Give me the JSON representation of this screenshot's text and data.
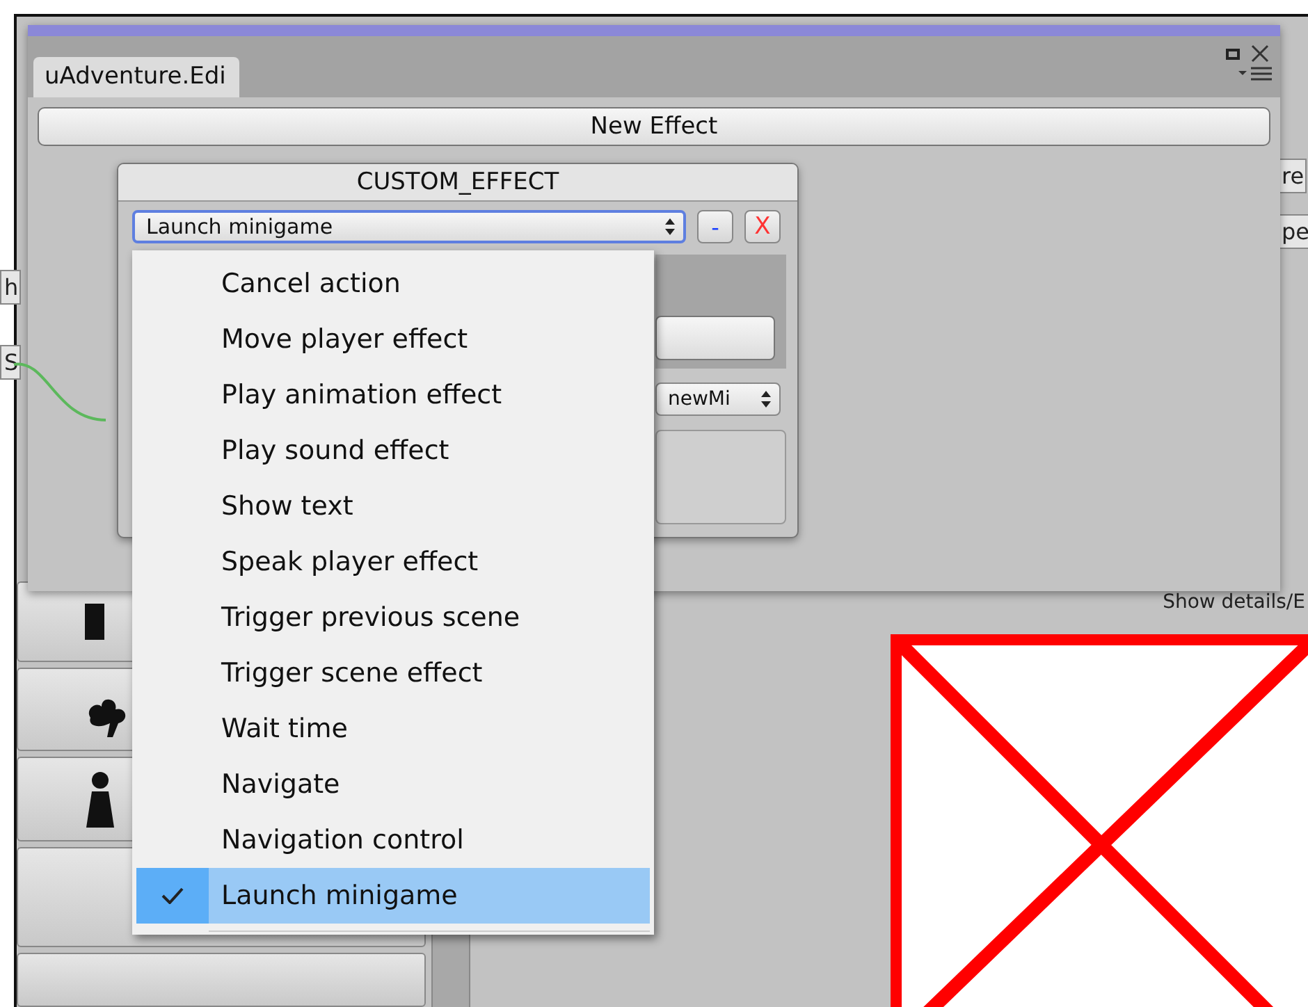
{
  "background": {
    "left_labels": [
      "h",
      "S"
    ],
    "right_labels": [
      "re",
      "pe"
    ],
    "details_label": "Show details/E"
  },
  "window": {
    "tab": "uAdventure.Edi",
    "new_effect_button": "New Effect"
  },
  "node": {
    "title": "CUSTOM_EFFECT",
    "effect_select": "Launch minigame",
    "remove_button": "-",
    "delete_button": "X",
    "minigame_select": "newMi"
  },
  "menu": {
    "items": [
      {
        "label": "Cancel action",
        "selected": false
      },
      {
        "label": "Move player effect",
        "selected": false
      },
      {
        "label": "Play animation effect",
        "selected": false
      },
      {
        "label": "Play sound effect",
        "selected": false
      },
      {
        "label": "Show text",
        "selected": false
      },
      {
        "label": "Speak player effect",
        "selected": false
      },
      {
        "label": "Trigger previous scene",
        "selected": false
      },
      {
        "label": "Trigger scene effect",
        "selected": false
      },
      {
        "label": "Wait time",
        "selected": false
      },
      {
        "label": "Navigate",
        "selected": false
      },
      {
        "label": "Navigation control",
        "selected": false
      },
      {
        "label": "Launch minigame",
        "selected": true
      }
    ]
  }
}
